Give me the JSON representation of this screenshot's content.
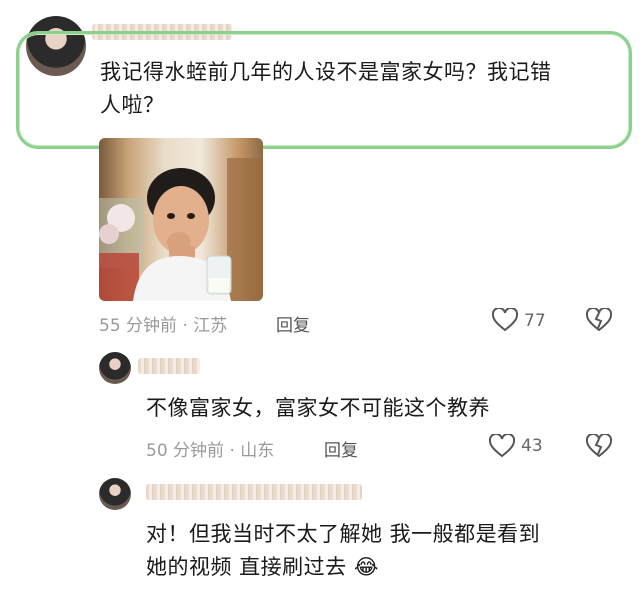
{
  "comments": [
    {
      "text_line1": "我记得水蛭前几年的人设不是富家女吗？我记错",
      "text_line2": "人啦？",
      "time": "55 分钟前 · 江苏",
      "reply": "回复",
      "likes": "77",
      "has_sticker": true
    },
    {
      "text_line1": "不像富家女，富家女不可能这个教养",
      "time": "50 分钟前 · 山东",
      "reply": "回复",
      "likes": "43"
    },
    {
      "text_line1": "对！但我当时不太了解她  我一般都是看到",
      "text_line2": "她的视频  直接刷过去",
      "emoji": "😂"
    }
  ],
  "icons": {
    "like": "heart-outline-icon",
    "dislike": "broken-heart-icon"
  },
  "colors": {
    "highlight_border": "#8cd08c",
    "meta_text": "#9a9a9a"
  }
}
